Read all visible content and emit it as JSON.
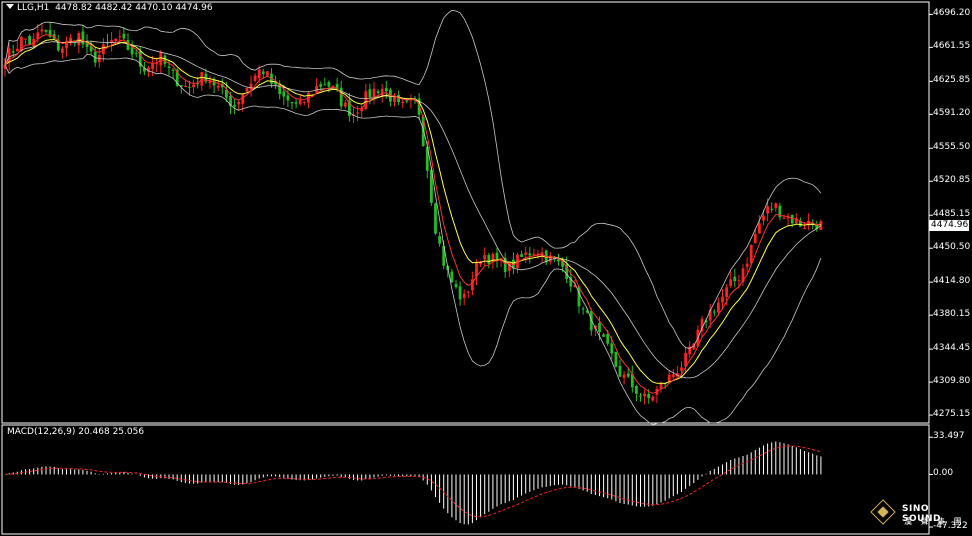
{
  "header": {
    "symbol": "LLG,H1",
    "ohlc": "4478.82 4482.42 4470.10 4474.96"
  },
  "macd_header": {
    "label": "MACD(12,26,9) 20.468 25.056"
  },
  "watermark": {
    "name": "SINO SOUND",
    "sub": "漢 聲 集 團"
  },
  "colors": {
    "background": "#000000",
    "bull_candle": "#ff2020",
    "bear_candle": "#20c020",
    "bollinger": "#c8c8c8",
    "ma_red": "#ff3030",
    "ma_yellow": "#ffff40",
    "macd_hist": "#ffffff",
    "macd_signal": "#ff2020",
    "grid_frame": "#ffffff"
  },
  "chart_data": {
    "type": "candlestick",
    "price_axis": {
      "ticks": [
        "4696.20",
        "4661.55",
        "4625.85",
        "4591.20",
        "4555.50",
        "4520.85",
        "4485.15",
        "4450.50",
        "4414.80",
        "4380.15",
        "4344.45",
        "4309.80",
        "4275.15"
      ],
      "current_price": "4474.96",
      "range": [
        4270,
        4705
      ]
    },
    "macd_axis": {
      "ticks": [
        "33.497",
        "0.00",
        "-47.322"
      ],
      "range": [
        -50,
        40
      ]
    },
    "close_path": [
      4650,
      4660,
      4672,
      4665,
      4680,
      4670,
      4660,
      4668,
      4675,
      4655,
      4650,
      4662,
      4670,
      4665,
      4655,
      4640,
      4645,
      4650,
      4635,
      4625,
      4618,
      4628,
      4632,
      4622,
      4610,
      4600,
      4615,
      4628,
      4640,
      4625,
      4610,
      4605,
      4598,
      4610,
      4620,
      4625,
      4615,
      4600,
      4592,
      4605,
      4615,
      4620,
      4610,
      4598,
      4600,
      4605,
      4540,
      4470,
      4430,
      4410,
      4395,
      4420,
      4445,
      4440,
      4435,
      4430,
      4438,
      4445,
      4450,
      4442,
      4436,
      4430,
      4410,
      4385,
      4370,
      4355,
      4340,
      4320,
      4310,
      4300,
      4290,
      4300,
      4310,
      4320,
      4330,
      4345,
      4370,
      4385,
      4395,
      4410,
      4420,
      4440,
      4470,
      4490,
      4495,
      4485,
      4480,
      4475,
      4478,
      4475
    ]
  }
}
